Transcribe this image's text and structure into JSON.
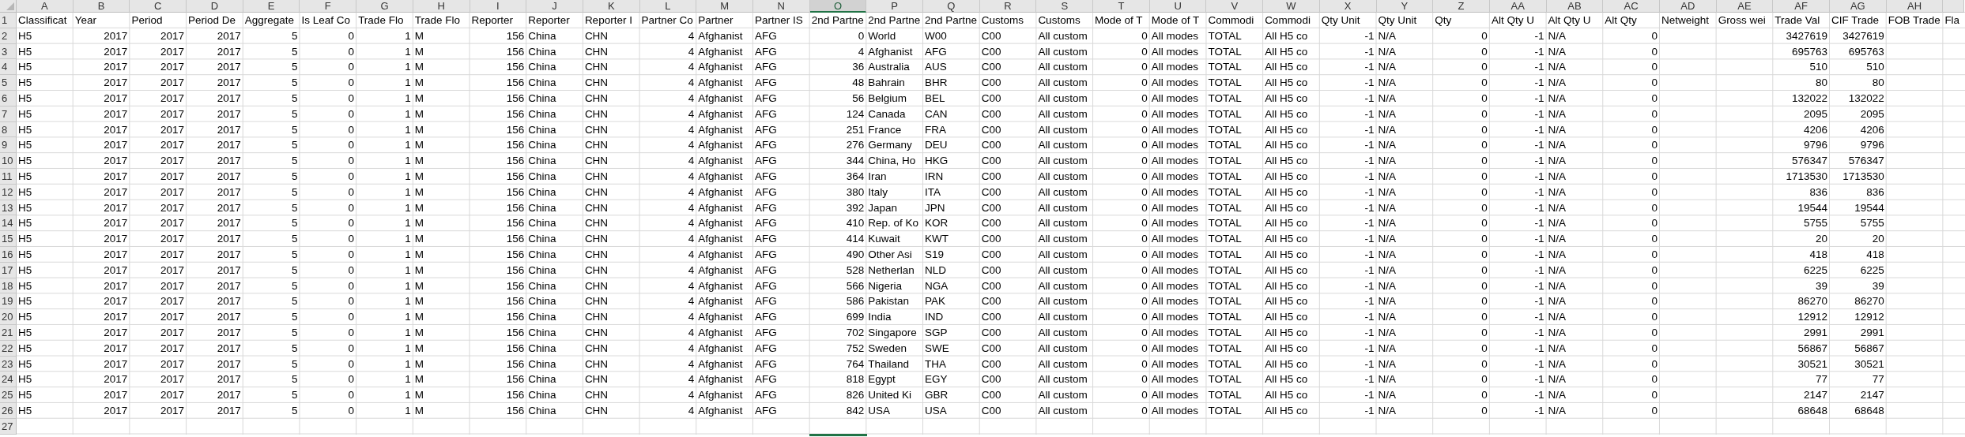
{
  "sheet": {
    "columns": [
      {
        "letter": "A",
        "selected": false
      },
      {
        "letter": "B",
        "selected": false
      },
      {
        "letter": "C",
        "selected": false
      },
      {
        "letter": "D",
        "selected": false
      },
      {
        "letter": "E",
        "selected": false
      },
      {
        "letter": "F",
        "selected": false
      },
      {
        "letter": "G",
        "selected": false
      },
      {
        "letter": "H",
        "selected": false
      },
      {
        "letter": "I",
        "selected": false
      },
      {
        "letter": "J",
        "selected": false
      },
      {
        "letter": "K",
        "selected": false
      },
      {
        "letter": "L",
        "selected": false
      },
      {
        "letter": "M",
        "selected": false
      },
      {
        "letter": "N",
        "selected": false
      },
      {
        "letter": "O",
        "selected": true
      },
      {
        "letter": "P",
        "selected": false
      },
      {
        "letter": "Q",
        "selected": false
      },
      {
        "letter": "R",
        "selected": false
      },
      {
        "letter": "S",
        "selected": false
      },
      {
        "letter": "T",
        "selected": false
      },
      {
        "letter": "U",
        "selected": false
      },
      {
        "letter": "V",
        "selected": false
      },
      {
        "letter": "W",
        "selected": false
      },
      {
        "letter": "X",
        "selected": false
      },
      {
        "letter": "Y",
        "selected": false
      },
      {
        "letter": "Z",
        "selected": false
      },
      {
        "letter": "AA",
        "selected": false
      },
      {
        "letter": "AB",
        "selected": false
      },
      {
        "letter": "AC",
        "selected": false
      },
      {
        "letter": "AD",
        "selected": false
      },
      {
        "letter": "AE",
        "selected": false
      },
      {
        "letter": "AF",
        "selected": false
      },
      {
        "letter": "AG",
        "selected": false
      },
      {
        "letter": "AH",
        "selected": false
      }
    ],
    "rows": [
      {
        "number": "1",
        "cells": [
          "Classificat",
          "Year",
          "Period",
          "Period De",
          "Aggregate",
          "Is Leaf Co",
          "Trade Flo",
          "Trade Flo",
          "Reporter",
          "Reporter",
          "Reporter I",
          "Partner Co",
          "Partner",
          "Partner IS",
          "2nd Partne",
          "2nd Partne",
          "2nd Partne",
          "Customs",
          "Customs",
          "Mode of T",
          "Mode of T",
          "Commodi",
          "Commodi",
          "Qty Unit",
          "Qty Unit",
          "Qty",
          "Alt Qty U",
          "Alt Qty U",
          "Alt Qty",
          "Netweight",
          "Gross wei",
          "Trade Val",
          "CIF Trade",
          "FOB Trade",
          "Fla"
        ]
      },
      {
        "number": "2",
        "cells": [
          "H5",
          "2017",
          "2017",
          "2017",
          "5",
          "0",
          "1",
          "M",
          "156",
          "China",
          "CHN",
          "4",
          "Afghanist",
          "AFG",
          "0",
          "World",
          "W00",
          "C00",
          "All custom",
          "0",
          "All modes",
          "TOTAL",
          "All H5 co",
          "-1",
          "N/A",
          "0",
          "-1",
          "N/A",
          "0",
          null,
          null,
          "3427619",
          "3427619"
        ]
      },
      {
        "number": "3",
        "cells": [
          "H5",
          "2017",
          "2017",
          "2017",
          "5",
          "0",
          "1",
          "M",
          "156",
          "China",
          "CHN",
          "4",
          "Afghanist",
          "AFG",
          "4",
          "Afghanist",
          "AFG",
          "C00",
          "All custom",
          "0",
          "All modes",
          "TOTAL",
          "All H5 co",
          "-1",
          "N/A",
          "0",
          "-1",
          "N/A",
          "0",
          null,
          null,
          "695763",
          "695763"
        ]
      },
      {
        "number": "4",
        "cells": [
          "H5",
          "2017",
          "2017",
          "2017",
          "5",
          "0",
          "1",
          "M",
          "156",
          "China",
          "CHN",
          "4",
          "Afghanist",
          "AFG",
          "36",
          "Australia",
          "AUS",
          "C00",
          "All custom",
          "0",
          "All modes",
          "TOTAL",
          "All H5 co",
          "-1",
          "N/A",
          "0",
          "-1",
          "N/A",
          "0",
          null,
          null,
          "510",
          "510"
        ]
      },
      {
        "number": "5",
        "cells": [
          "H5",
          "2017",
          "2017",
          "2017",
          "5",
          "0",
          "1",
          "M",
          "156",
          "China",
          "CHN",
          "4",
          "Afghanist",
          "AFG",
          "48",
          "Bahrain",
          "BHR",
          "C00",
          "All custom",
          "0",
          "All modes",
          "TOTAL",
          "All H5 co",
          "-1",
          "N/A",
          "0",
          "-1",
          "N/A",
          "0",
          null,
          null,
          "80",
          "80"
        ]
      },
      {
        "number": "6",
        "cells": [
          "H5",
          "2017",
          "2017",
          "2017",
          "5",
          "0",
          "1",
          "M",
          "156",
          "China",
          "CHN",
          "4",
          "Afghanist",
          "AFG",
          "56",
          "Belgium",
          "BEL",
          "C00",
          "All custom",
          "0",
          "All modes",
          "TOTAL",
          "All H5 co",
          "-1",
          "N/A",
          "0",
          "-1",
          "N/A",
          "0",
          null,
          null,
          "132022",
          "132022"
        ]
      },
      {
        "number": "7",
        "cells": [
          "H5",
          "2017",
          "2017",
          "2017",
          "5",
          "0",
          "1",
          "M",
          "156",
          "China",
          "CHN",
          "4",
          "Afghanist",
          "AFG",
          "124",
          "Canada",
          "CAN",
          "C00",
          "All custom",
          "0",
          "All modes",
          "TOTAL",
          "All H5 co",
          "-1",
          "N/A",
          "0",
          "-1",
          "N/A",
          "0",
          null,
          null,
          "2095",
          "2095"
        ]
      },
      {
        "number": "8",
        "cells": [
          "H5",
          "2017",
          "2017",
          "2017",
          "5",
          "0",
          "1",
          "M",
          "156",
          "China",
          "CHN",
          "4",
          "Afghanist",
          "AFG",
          "251",
          "France",
          "FRA",
          "C00",
          "All custom",
          "0",
          "All modes",
          "TOTAL",
          "All H5 co",
          "-1",
          "N/A",
          "0",
          "-1",
          "N/A",
          "0",
          null,
          null,
          "4206",
          "4206"
        ]
      },
      {
        "number": "9",
        "cells": [
          "H5",
          "2017",
          "2017",
          "2017",
          "5",
          "0",
          "1",
          "M",
          "156",
          "China",
          "CHN",
          "4",
          "Afghanist",
          "AFG",
          "276",
          "Germany",
          "DEU",
          "C00",
          "All custom",
          "0",
          "All modes",
          "TOTAL",
          "All H5 co",
          "-1",
          "N/A",
          "0",
          "-1",
          "N/A",
          "0",
          null,
          null,
          "9796",
          "9796"
        ]
      },
      {
        "number": "10",
        "cells": [
          "H5",
          "2017",
          "2017",
          "2017",
          "5",
          "0",
          "1",
          "M",
          "156",
          "China",
          "CHN",
          "4",
          "Afghanist",
          "AFG",
          "344",
          "China, Ho",
          "HKG",
          "C00",
          "All custom",
          "0",
          "All modes",
          "TOTAL",
          "All H5 co",
          "-1",
          "N/A",
          "0",
          "-1",
          "N/A",
          "0",
          null,
          null,
          "576347",
          "576347"
        ]
      },
      {
        "number": "11",
        "cells": [
          "H5",
          "2017",
          "2017",
          "2017",
          "5",
          "0",
          "1",
          "M",
          "156",
          "China",
          "CHN",
          "4",
          "Afghanist",
          "AFG",
          "364",
          "Iran",
          "IRN",
          "C00",
          "All custom",
          "0",
          "All modes",
          "TOTAL",
          "All H5 co",
          "-1",
          "N/A",
          "0",
          "-1",
          "N/A",
          "0",
          null,
          null,
          "1713530",
          "1713530"
        ]
      },
      {
        "number": "12",
        "cells": [
          "H5",
          "2017",
          "2017",
          "2017",
          "5",
          "0",
          "1",
          "M",
          "156",
          "China",
          "CHN",
          "4",
          "Afghanist",
          "AFG",
          "380",
          "Italy",
          "ITA",
          "C00",
          "All custom",
          "0",
          "All modes",
          "TOTAL",
          "All H5 co",
          "-1",
          "N/A",
          "0",
          "-1",
          "N/A",
          "0",
          null,
          null,
          "836",
          "836"
        ]
      },
      {
        "number": "13",
        "cells": [
          "H5",
          "2017",
          "2017",
          "2017",
          "5",
          "0",
          "1",
          "M",
          "156",
          "China",
          "CHN",
          "4",
          "Afghanist",
          "AFG",
          "392",
          "Japan",
          "JPN",
          "C00",
          "All custom",
          "0",
          "All modes",
          "TOTAL",
          "All H5 co",
          "-1",
          "N/A",
          "0",
          "-1",
          "N/A",
          "0",
          null,
          null,
          "19544",
          "19544"
        ]
      },
      {
        "number": "14",
        "cells": [
          "H5",
          "2017",
          "2017",
          "2017",
          "5",
          "0",
          "1",
          "M",
          "156",
          "China",
          "CHN",
          "4",
          "Afghanist",
          "AFG",
          "410",
          "Rep. of Ko",
          "KOR",
          "C00",
          "All custom",
          "0",
          "All modes",
          "TOTAL",
          "All H5 co",
          "-1",
          "N/A",
          "0",
          "-1",
          "N/A",
          "0",
          null,
          null,
          "5755",
          "5755"
        ]
      },
      {
        "number": "15",
        "cells": [
          "H5",
          "2017",
          "2017",
          "2017",
          "5",
          "0",
          "1",
          "M",
          "156",
          "China",
          "CHN",
          "4",
          "Afghanist",
          "AFG",
          "414",
          "Kuwait",
          "KWT",
          "C00",
          "All custom",
          "0",
          "All modes",
          "TOTAL",
          "All H5 co",
          "-1",
          "N/A",
          "0",
          "-1",
          "N/A",
          "0",
          null,
          null,
          "20",
          "20"
        ]
      },
      {
        "number": "16",
        "cells": [
          "H5",
          "2017",
          "2017",
          "2017",
          "5",
          "0",
          "1",
          "M",
          "156",
          "China",
          "CHN",
          "4",
          "Afghanist",
          "AFG",
          "490",
          "Other Asi",
          "S19",
          "C00",
          "All custom",
          "0",
          "All modes",
          "TOTAL",
          "All H5 co",
          "-1",
          "N/A",
          "0",
          "-1",
          "N/A",
          "0",
          null,
          null,
          "418",
          "418"
        ]
      },
      {
        "number": "17",
        "cells": [
          "H5",
          "2017",
          "2017",
          "2017",
          "5",
          "0",
          "1",
          "M",
          "156",
          "China",
          "CHN",
          "4",
          "Afghanist",
          "AFG",
          "528",
          "Netherlan",
          "NLD",
          "C00",
          "All custom",
          "0",
          "All modes",
          "TOTAL",
          "All H5 co",
          "-1",
          "N/A",
          "0",
          "-1",
          "N/A",
          "0",
          null,
          null,
          "6225",
          "6225"
        ]
      },
      {
        "number": "18",
        "cells": [
          "H5",
          "2017",
          "2017",
          "2017",
          "5",
          "0",
          "1",
          "M",
          "156",
          "China",
          "CHN",
          "4",
          "Afghanist",
          "AFG",
          "566",
          "Nigeria",
          "NGA",
          "C00",
          "All custom",
          "0",
          "All modes",
          "TOTAL",
          "All H5 co",
          "-1",
          "N/A",
          "0",
          "-1",
          "N/A",
          "0",
          null,
          null,
          "39",
          "39"
        ]
      },
      {
        "number": "19",
        "cells": [
          "H5",
          "2017",
          "2017",
          "2017",
          "5",
          "0",
          "1",
          "M",
          "156",
          "China",
          "CHN",
          "4",
          "Afghanist",
          "AFG",
          "586",
          "Pakistan",
          "PAK",
          "C00",
          "All custom",
          "0",
          "All modes",
          "TOTAL",
          "All H5 co",
          "-1",
          "N/A",
          "0",
          "-1",
          "N/A",
          "0",
          null,
          null,
          "86270",
          "86270"
        ]
      },
      {
        "number": "20",
        "cells": [
          "H5",
          "2017",
          "2017",
          "2017",
          "5",
          "0",
          "1",
          "M",
          "156",
          "China",
          "CHN",
          "4",
          "Afghanist",
          "AFG",
          "699",
          "India",
          "IND",
          "C00",
          "All custom",
          "0",
          "All modes",
          "TOTAL",
          "All H5 co",
          "-1",
          "N/A",
          "0",
          "-1",
          "N/A",
          "0",
          null,
          null,
          "12912",
          "12912"
        ]
      },
      {
        "number": "21",
        "cells": [
          "H5",
          "2017",
          "2017",
          "2017",
          "5",
          "0",
          "1",
          "M",
          "156",
          "China",
          "CHN",
          "4",
          "Afghanist",
          "AFG",
          "702",
          "Singapore",
          "SGP",
          "C00",
          "All custom",
          "0",
          "All modes",
          "TOTAL",
          "All H5 co",
          "-1",
          "N/A",
          "0",
          "-1",
          "N/A",
          "0",
          null,
          null,
          "2991",
          "2991"
        ]
      },
      {
        "number": "22",
        "cells": [
          "H5",
          "2017",
          "2017",
          "2017",
          "5",
          "0",
          "1",
          "M",
          "156",
          "China",
          "CHN",
          "4",
          "Afghanist",
          "AFG",
          "752",
          "Sweden",
          "SWE",
          "C00",
          "All custom",
          "0",
          "All modes",
          "TOTAL",
          "All H5 co",
          "-1",
          "N/A",
          "0",
          "-1",
          "N/A",
          "0",
          null,
          null,
          "56867",
          "56867"
        ]
      },
      {
        "number": "23",
        "cells": [
          "H5",
          "2017",
          "2017",
          "2017",
          "5",
          "0",
          "1",
          "M",
          "156",
          "China",
          "CHN",
          "4",
          "Afghanist",
          "AFG",
          "764",
          "Thailand",
          "THA",
          "C00",
          "All custom",
          "0",
          "All modes",
          "TOTAL",
          "All H5 co",
          "-1",
          "N/A",
          "0",
          "-1",
          "N/A",
          "0",
          null,
          null,
          "30521",
          "30521"
        ]
      },
      {
        "number": "24",
        "cells": [
          "H5",
          "2017",
          "2017",
          "2017",
          "5",
          "0",
          "1",
          "M",
          "156",
          "China",
          "CHN",
          "4",
          "Afghanist",
          "AFG",
          "818",
          "Egypt",
          "EGY",
          "C00",
          "All custom",
          "0",
          "All modes",
          "TOTAL",
          "All H5 co",
          "-1",
          "N/A",
          "0",
          "-1",
          "N/A",
          "0",
          null,
          null,
          "77",
          "77"
        ]
      },
      {
        "number": "25",
        "cells": [
          "H5",
          "2017",
          "2017",
          "2017",
          "5",
          "0",
          "1",
          "M",
          "156",
          "China",
          "CHN",
          "4",
          "Afghanist",
          "AFG",
          "826",
          "United Ki",
          "GBR",
          "C00",
          "All custom",
          "0",
          "All modes",
          "TOTAL",
          "All H5 co",
          "-1",
          "N/A",
          "0",
          "-1",
          "N/A",
          "0",
          null,
          null,
          "2147",
          "2147"
        ]
      },
      {
        "number": "26",
        "cells": [
          "H5",
          "2017",
          "2017",
          "2017",
          "5",
          "0",
          "1",
          "M",
          "156",
          "China",
          "CHN",
          "4",
          "Afghanist",
          "AFG",
          "842",
          "USA",
          "USA",
          "C00",
          "All custom",
          "0",
          "All modes",
          "TOTAL",
          "All H5 co",
          "-1",
          "N/A",
          "0",
          "-1",
          "N/A",
          "0",
          null,
          null,
          "68648",
          "68648"
        ]
      },
      {
        "number": "27",
        "cells": []
      }
    ]
  }
}
